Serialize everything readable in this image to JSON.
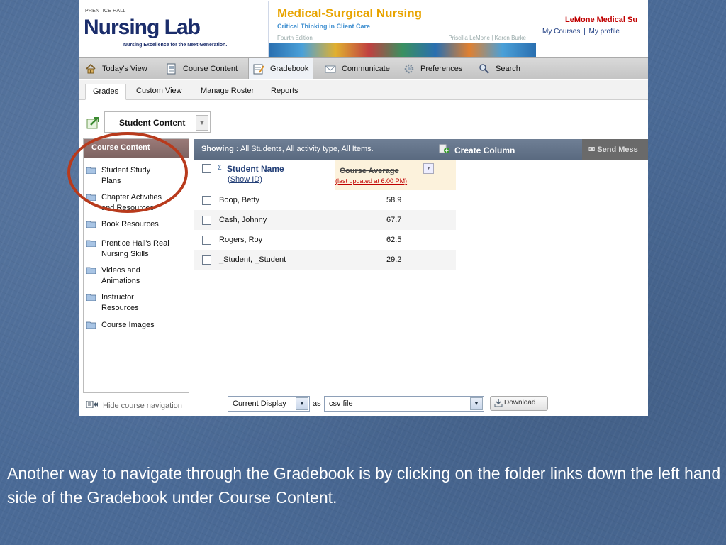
{
  "header": {
    "brand_prefix": "PRENTICE HALL",
    "brand_name": "Nursing Lab",
    "brand_tagline": "Nursing Excellence for the Next Generation.",
    "book_title": "Medical-Surgical Nursing",
    "book_subtitle": "Critical Thinking in Client Care",
    "edition": "Fourth Edition",
    "authors": "Priscilla LeMone | Karen Burke",
    "course_title": "LeMone Medical Su",
    "link_courses": "My Courses",
    "link_sep": "|",
    "link_profile": "My profile"
  },
  "topnav": {
    "items": [
      {
        "label": "Today's View",
        "icon": "home-icon"
      },
      {
        "label": "Course Content",
        "icon": "document-icon"
      },
      {
        "label": "Gradebook",
        "icon": "gradebook-icon"
      },
      {
        "label": "Communicate",
        "icon": "envelope-icon"
      },
      {
        "label": "Preferences",
        "icon": "gear-icon"
      },
      {
        "label": "Search",
        "icon": "search-icon"
      }
    ],
    "active": "Gradebook"
  },
  "subtabs": {
    "items": [
      {
        "label": "Grades"
      },
      {
        "label": "Custom View"
      },
      {
        "label": "Manage Roster"
      },
      {
        "label": "Reports"
      }
    ],
    "active": "Grades"
  },
  "content_selector": {
    "label": "Student Content",
    "icon": "export-icon"
  },
  "left_panel": {
    "title": "Course Content",
    "items": [
      {
        "label_1": "Student Study",
        "label_2": "Plans"
      },
      {
        "label_1": "Chapter Activities",
        "label_2": "and Resources"
      },
      {
        "label_1": "Book Resources",
        "label_2": ""
      },
      {
        "label_1": "Prentice Hall's Real",
        "label_2": "Nursing Skills"
      },
      {
        "label_1": "Videos and",
        "label_2": "Animations"
      },
      {
        "label_1": "Instructor",
        "label_2": "Resources"
      },
      {
        "label_1": "Course Images",
        "label_2": ""
      }
    ],
    "hide_nav": "Hide course navigation"
  },
  "gradebook": {
    "showing_label": "Showing :",
    "showing_value": "All Students, All activity type, All Items.",
    "create_column": "Create Column",
    "send_message": "Send Mess",
    "col_name": "Student Name",
    "col_name_sort": "Σ",
    "show_id": "(Show ID)",
    "col_avg": "Course Average",
    "col_avg_updated": "(last updated at 6:00 PM)",
    "rows": [
      {
        "name": "Boop, Betty",
        "avg": "58.9"
      },
      {
        "name": "Cash, Johnny",
        "avg": "67.7"
      },
      {
        "name": "Rogers, Roy",
        "avg": "62.5"
      },
      {
        "name": "_Student, _Student",
        "avg": "29.2"
      }
    ]
  },
  "export": {
    "display_value": "Current Display",
    "as_label": "as",
    "format_value": "csv file",
    "download_label": "Download"
  },
  "caption": "Another way to navigate through the Gradebook is by clicking on the folder links down the left hand side of the Gradebook under Course Content.",
  "colors": {
    "slide_background": "#4a6a96",
    "annotation_circle": "#b83a1c",
    "course_title": "#c00000",
    "panel_header": "#7e6462",
    "gradebook_header": "#5a6a80"
  }
}
